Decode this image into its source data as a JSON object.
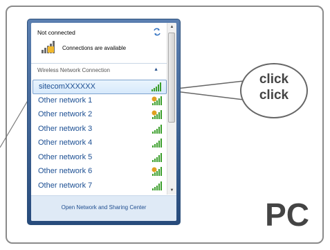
{
  "status": {
    "title": "Not connected",
    "availability": "Connections are available"
  },
  "section": {
    "label": "Wireless Network Connection"
  },
  "networks": [
    {
      "name": "sitecomXXXXXX",
      "selected": true,
      "secured": false
    },
    {
      "name": "Other network 1",
      "selected": false,
      "secured": true
    },
    {
      "name": "Other network 2",
      "selected": false,
      "secured": true
    },
    {
      "name": "Other network 3",
      "selected": false,
      "secured": false
    },
    {
      "name": "Other network 4",
      "selected": false,
      "secured": false
    },
    {
      "name": "Other network 5",
      "selected": false,
      "secured": false
    },
    {
      "name": "Other network 6",
      "selected": false,
      "secured": true
    },
    {
      "name": "Other network 7",
      "selected": false,
      "secured": false
    }
  ],
  "footer": {
    "link": "Open Network and Sharing Center"
  },
  "callout": {
    "line1": "click",
    "line2": "click"
  },
  "device_label": "PC",
  "colors": {
    "signal": "#3a9e2a",
    "shield": "#e0a020",
    "link": "#1c4f93"
  },
  "icons": {
    "refresh": "refresh-icon",
    "connections": "network-connections-icon",
    "signal": "signal-strength-icon"
  }
}
